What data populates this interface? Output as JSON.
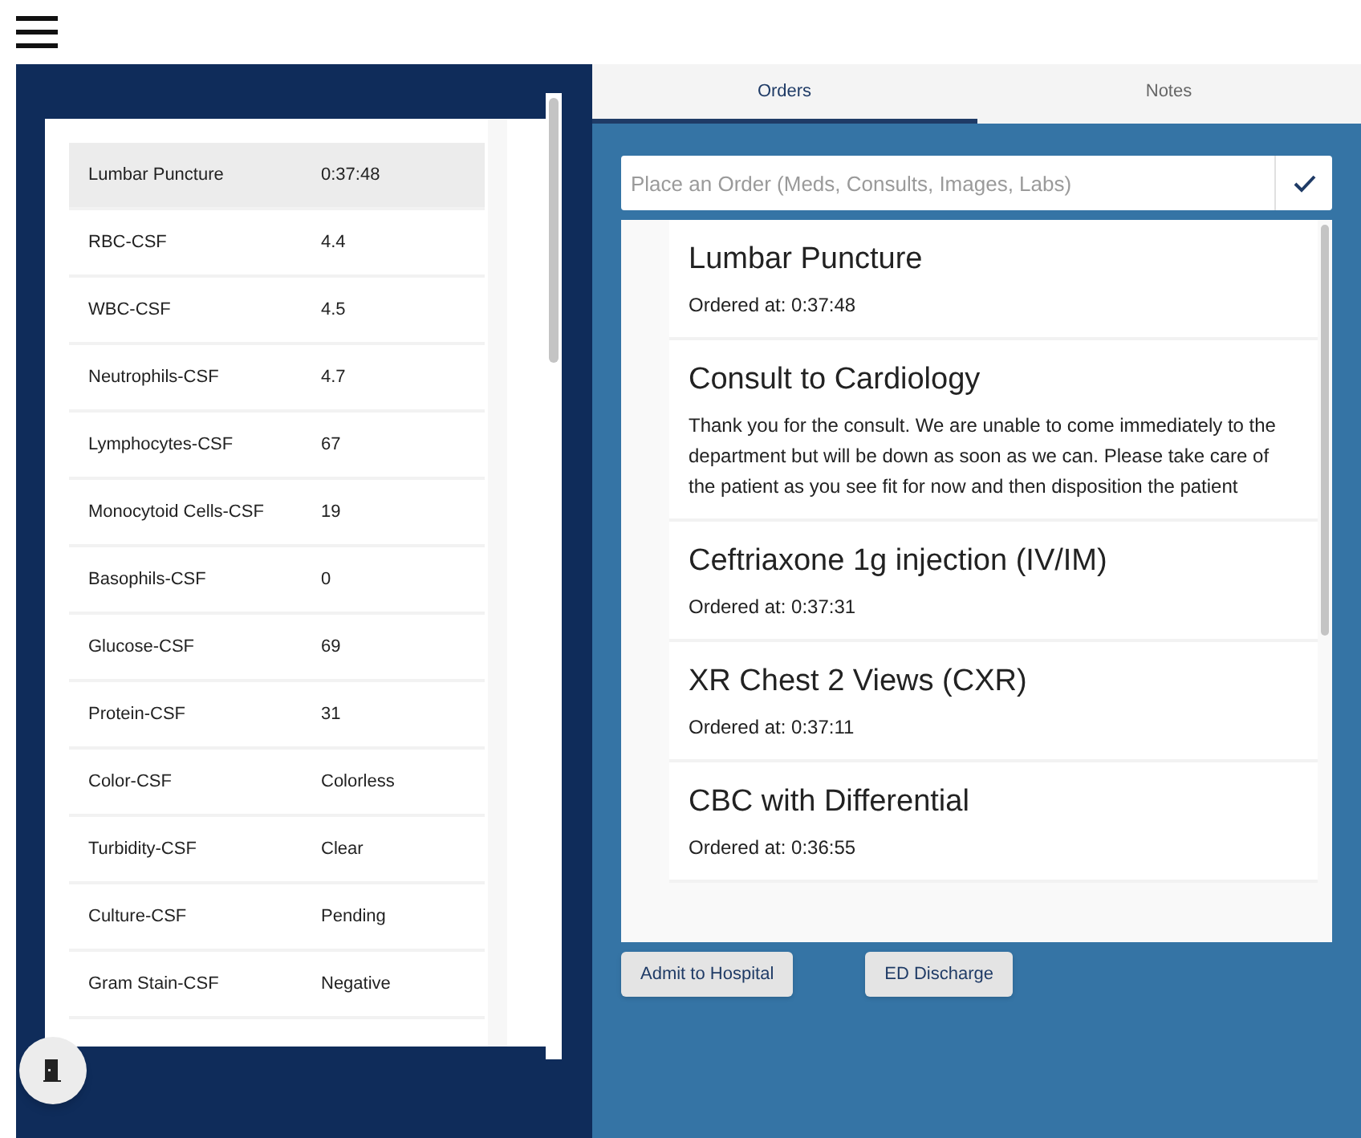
{
  "labs": [
    {
      "name": "Lumbar Puncture",
      "value": "0:37:48",
      "selected": true
    },
    {
      "name": "RBC-CSF",
      "value": "4.4",
      "selected": false
    },
    {
      "name": "WBC-CSF",
      "value": "4.5",
      "selected": false
    },
    {
      "name": "Neutrophils-CSF",
      "value": "4.7",
      "selected": false
    },
    {
      "name": "Lymphocytes-CSF",
      "value": "67",
      "selected": false
    },
    {
      "name": "Monocytoid Cells-CSF",
      "value": "19",
      "selected": false
    },
    {
      "name": "Basophils-CSF",
      "value": "0",
      "selected": false
    },
    {
      "name": "Glucose-CSF",
      "value": "69",
      "selected": false
    },
    {
      "name": "Protein-CSF",
      "value": "31",
      "selected": false
    },
    {
      "name": "Color-CSF",
      "value": "Colorless",
      "selected": false
    },
    {
      "name": "Turbidity-CSF",
      "value": "Clear",
      "selected": false
    },
    {
      "name": "Culture-CSF",
      "value": "Pending",
      "selected": false
    },
    {
      "name": "Gram Stain-CSF",
      "value": "Negative",
      "selected": false
    }
  ],
  "tabs": [
    {
      "label": "Orders",
      "selected": true
    },
    {
      "label": "Notes",
      "selected": false
    }
  ],
  "order_field": {
    "placeholder": "Place an Order (Meds, Consults, Images, Labs)"
  },
  "orders": [
    {
      "title": "Lumbar Puncture",
      "detail": "Ordered at: 0:37:48"
    },
    {
      "title": "Consult to Cardiology",
      "detail": "Thank you for the consult. We are unable to come immediately to the department but will be down as soon as we can. Please take care of the patient as you see fit for now and then disposition the patient"
    },
    {
      "title": "Ceftriaxone 1g injection (IV/IM)",
      "detail": "Ordered at: 0:37:31"
    },
    {
      "title": "XR Chest 2 Views (CXR)",
      "detail": "Ordered at: 0:37:11"
    },
    {
      "title": "CBC with Differential",
      "detail": "Ordered at: 0:36:55"
    }
  ],
  "buttons": [
    "Admit to Hospital",
    "ED Discharge"
  ]
}
